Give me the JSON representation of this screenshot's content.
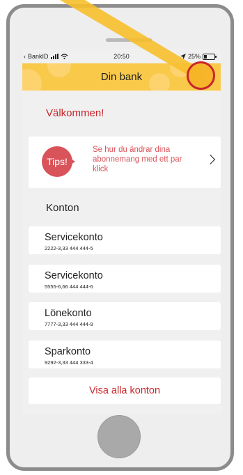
{
  "status_bar": {
    "carrier": "BankID",
    "time": "20:50",
    "battery": "25%"
  },
  "header": {
    "title": "Din bank"
  },
  "welcome": "Välkommen!",
  "tips": {
    "badge": "Tips!",
    "text": "Se hur du ändrar dina abonnemang med ett par klick"
  },
  "accounts_section": {
    "title": "Konton",
    "items": [
      {
        "name": "Servicekonto",
        "number": "2222-3,33 444 444-5"
      },
      {
        "name": "Servicekonto",
        "number": "5555-6,66 444 444-6"
      },
      {
        "name": "Lönekonto",
        "number": "7777-3,33 444 444-9"
      },
      {
        "name": "Sparkonto",
        "number": "9292-3,33 444 333-4"
      }
    ],
    "show_all": "Visa alla konton"
  },
  "colors": {
    "accent_red": "#c9262c",
    "header_yellow": "#f9c94a",
    "tips_red": "#d9535a",
    "phone_frame": "#8c8c8c"
  }
}
